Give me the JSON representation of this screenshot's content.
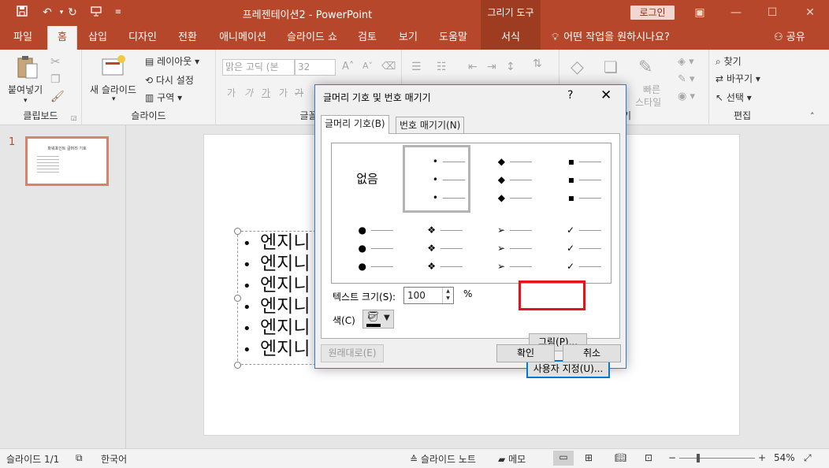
{
  "titlebar": {
    "title": "프레젠테이션2  -  PowerPoint",
    "context_tab_group": "그리기 도구",
    "login": "로그인",
    "qat_icons": [
      "save-icon",
      "undo-icon",
      "redo-icon",
      "present-icon",
      "customize-icon"
    ]
  },
  "tabs": [
    {
      "label": "파일"
    },
    {
      "label": "홈"
    },
    {
      "label": "삽입"
    },
    {
      "label": "디자인"
    },
    {
      "label": "전환"
    },
    {
      "label": "애니메이션"
    },
    {
      "label": "슬라이드 쇼"
    },
    {
      "label": "검토"
    },
    {
      "label": "보기"
    },
    {
      "label": "도움말"
    },
    {
      "label": "서식"
    }
  ],
  "tell_me": "어떤 작업을 원하시나요?",
  "share": "공유",
  "ribbon": {
    "clipboard": {
      "paste": "붙여넣기",
      "label": "클립보드"
    },
    "slides": {
      "new_slide": "새 슬라이드",
      "layout": "레이아웃",
      "reset": "다시 설정",
      "section": "구역",
      "label": "슬라이드"
    },
    "font": {
      "font_name": "맑은 고딕 (본",
      "font_size": "32",
      "label": "글꼴",
      "format_chars": [
        "가",
        "가",
        "가",
        "가",
        "가"
      ]
    },
    "drawing": {
      "quick_styles": "빠른",
      "quick_styles_2": "스타일",
      "label": "기"
    },
    "editing": {
      "find": "찾기",
      "replace": "바꾸기",
      "select": "선택",
      "label": "편집"
    }
  },
  "slide_panel": {
    "slide_number": "1",
    "thumb_title": "파워포인트 글머리 기호"
  },
  "slide": {
    "lines": [
      "엔지니",
      "엔지니",
      "엔지니",
      "엔지니",
      "엔지니",
      "엔지니"
    ]
  },
  "dialog": {
    "title": "글머리 기호 및 번호 매기기",
    "help": "?",
    "tab_bullets": "글머리 기호(B)",
    "tab_numbers": "번호 매기기(N)",
    "none_label": "없음",
    "bullet_symbols": [
      "•",
      "◆",
      "▪",
      "●",
      "❖",
      "➢",
      "✓"
    ],
    "size_label": "텍스트 크기(S):",
    "size_value": "100",
    "size_unit": "%",
    "color_label": "색(C)",
    "picture_button": "그림(P)...",
    "customize_button": "사용자 지정(U)...",
    "reset_button": "원래대로(E)",
    "ok_button": "확인",
    "cancel_button": "취소"
  },
  "statusbar": {
    "slide_info": "슬라이드 1/1",
    "language": "한국어",
    "notes": "슬라이드 노트",
    "comments": "메모",
    "zoom": "54%"
  },
  "colors": {
    "accent": "#b7472a",
    "context_tab": "#9e3c22",
    "highlight_box": "#e3141c",
    "dialog_border": "#3a77c9"
  }
}
